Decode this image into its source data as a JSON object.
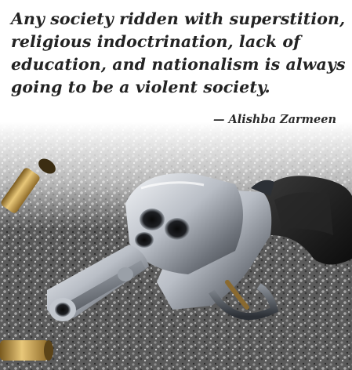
{
  "quote": {
    "lines": [
      "Any society ridden with superstition,",
      "religious indoctrination, lack of",
      "education, and nationalism is always",
      "going to be a violent society."
    ],
    "attribution": "— Alishba Zarmeen"
  },
  "image": {
    "subject-icon": "revolver-on-gravel-with-bullet-casings-icon"
  },
  "colors": {
    "text": "#232323",
    "background": "#ffffff",
    "gravel": "#5a5a5a",
    "steel": "#c8ccd2",
    "grip": "#1c1c1c",
    "brass": "#c9a04a"
  }
}
